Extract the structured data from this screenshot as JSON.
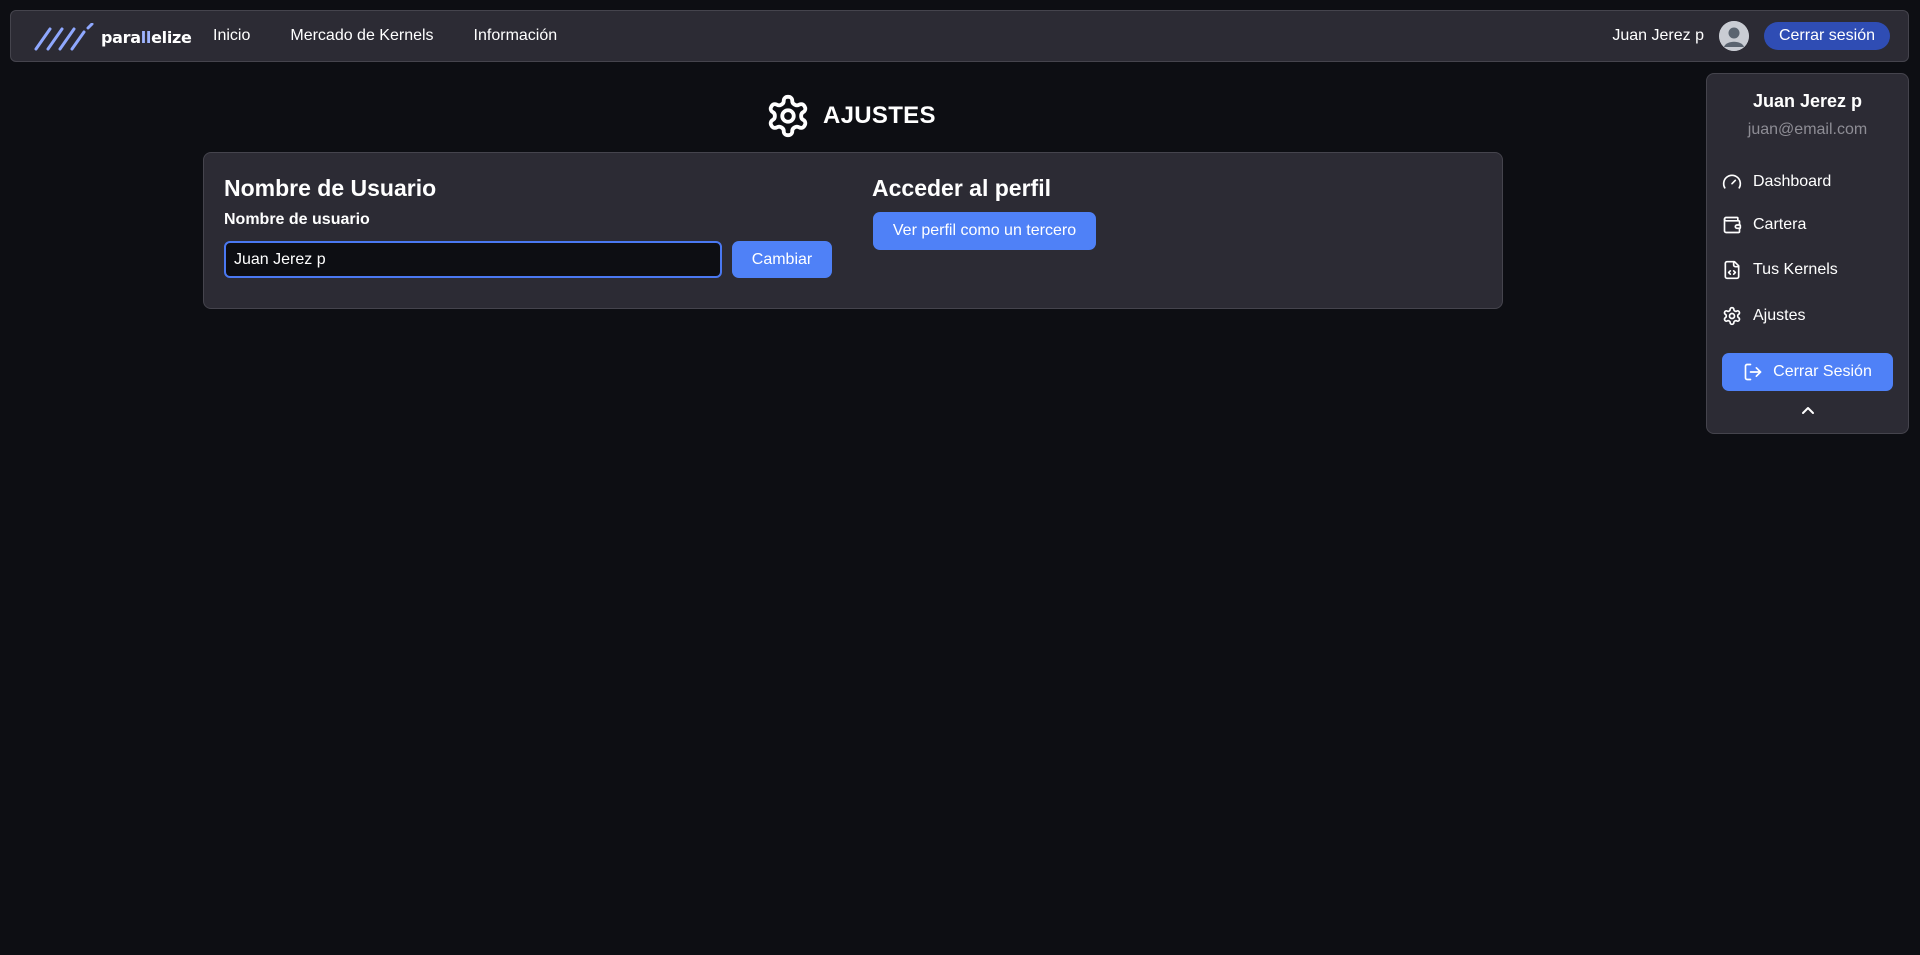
{
  "navbar": {
    "logo_prefix": "para",
    "logo_accent": "ll",
    "logo_suffix": "elize",
    "links": [
      "Inicio",
      "Mercado de Kernels",
      "Información"
    ],
    "username": "Juan Jerez p",
    "logout_label": "Cerrar sesión"
  },
  "page": {
    "title": "AJUSTES",
    "title_icon": "gear-icon"
  },
  "settings": {
    "username_section_title": "Nombre de Usuario",
    "username_label": "Nombre de usuario",
    "username_value": "Juan Jerez p",
    "change_button": "Cambiar",
    "profile_section_title": "Acceder al perfil",
    "view_profile_button": "Ver perfil como un tercero"
  },
  "dropdown": {
    "name": "Juan Jerez p",
    "email": "juan@email.com",
    "items": [
      {
        "label": "Dashboard",
        "icon": "gauge-icon"
      },
      {
        "label": "Cartera",
        "icon": "wallet-icon"
      },
      {
        "label": "Tus Kernels",
        "icon": "code-file-icon"
      },
      {
        "label": "Ajustes",
        "icon": "gear-icon"
      }
    ],
    "logout_label": "Cerrar Sesión",
    "collapse_icon": "chevron-up-icon"
  },
  "colors": {
    "background": "#0d0e13",
    "panel": "#2c2b34",
    "accent": "#4f81f7",
    "accent_dark": "#2f4db4",
    "logo_accent": "#9fb5ff"
  }
}
